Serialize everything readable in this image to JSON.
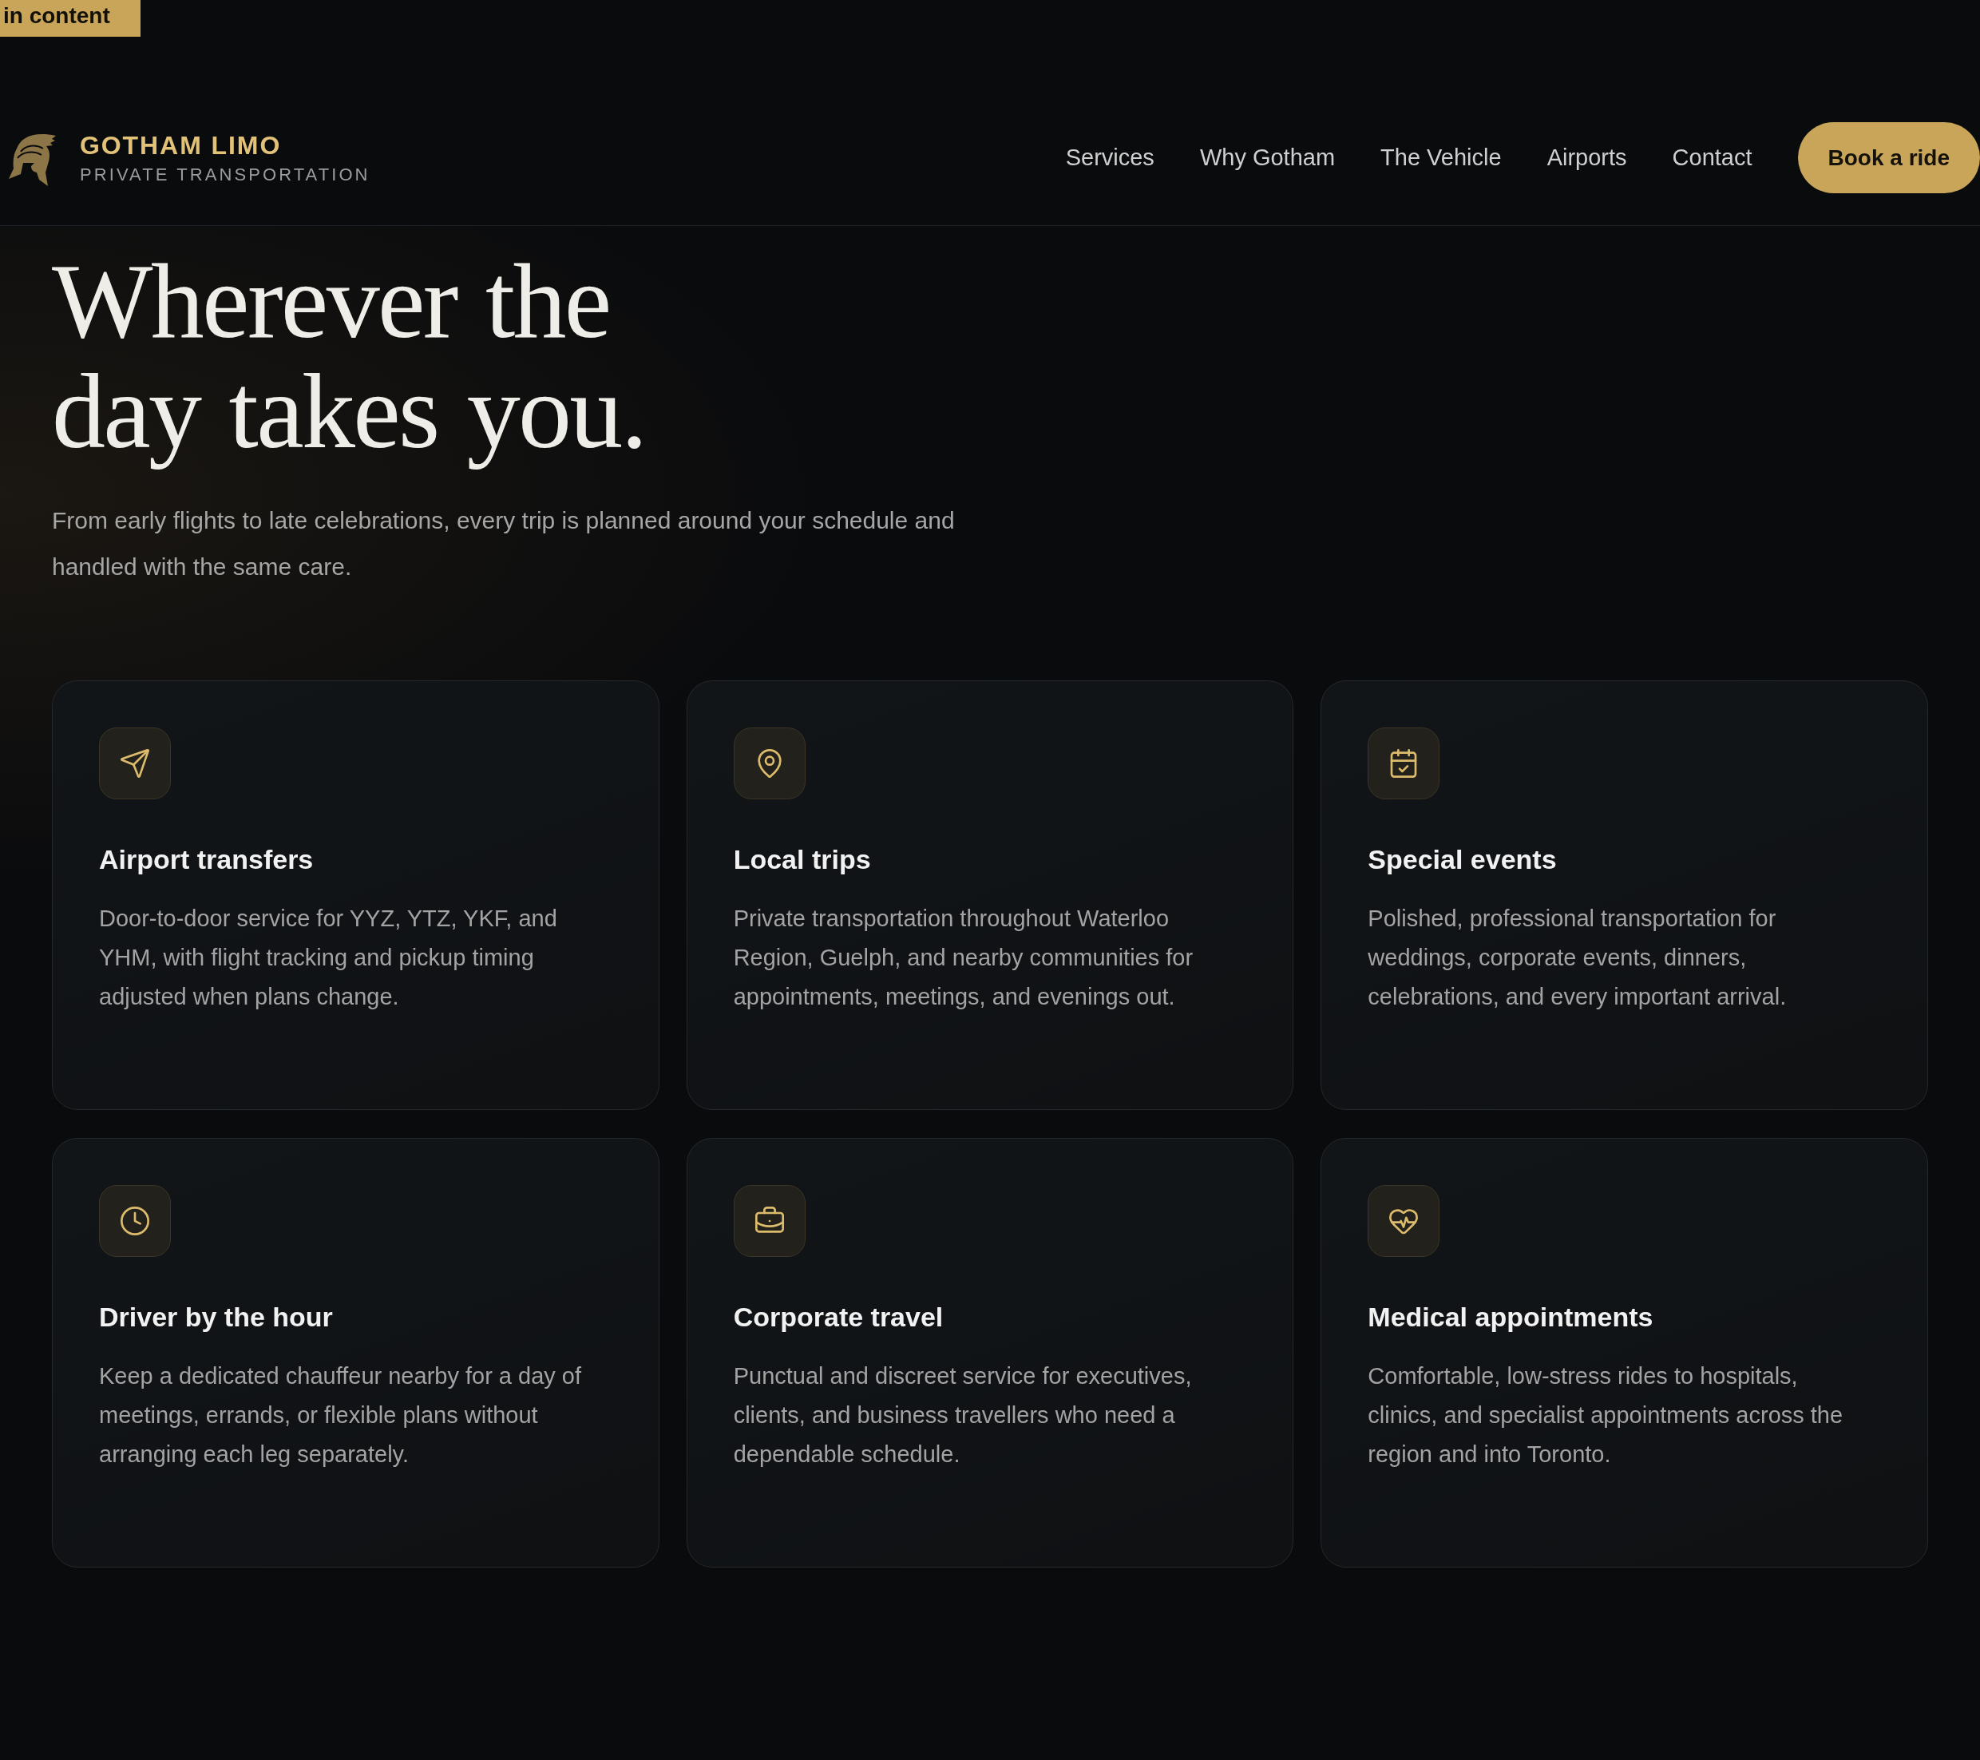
{
  "skip_link": {
    "label": "in content"
  },
  "header": {
    "brand": {
      "name": "GOTHAM LIMO",
      "tagline": "PRIVATE TRANSPORTATION"
    },
    "nav": [
      {
        "label": "Services"
      },
      {
        "label": "Why Gotham"
      },
      {
        "label": "The Vehicle"
      },
      {
        "label": "Airports"
      },
      {
        "label": "Contact"
      }
    ],
    "cta": {
      "label": "Book a ride"
    }
  },
  "hero": {
    "title": "Wherever the day takes you.",
    "subtitle": "From early flights to late celebrations, every trip is planned around your schedule and handled with the same care."
  },
  "services": [
    {
      "title": "Airport transfers",
      "description": "Door-to-door service for YYZ, YTZ, YKF, and YHM, with flight tracking and pickup timing adjusted when plans change."
    },
    {
      "title": "Local trips",
      "description": "Private transportation throughout Waterloo Region, Guelph, and nearby communities for appointments, meetings, and evenings out."
    },
    {
      "title": "Special events",
      "description": "Polished, professional transportation for weddings, corporate events, dinners, celebrations, and every important arrival."
    },
    {
      "title": "Driver by the hour",
      "description": "Keep a dedicated chauffeur nearby for a day of meetings, errands, or flexible plans without arranging each leg separately."
    },
    {
      "title": "Corporate travel",
      "description": "Punctual and discreet service for executives, clients, and business travellers who need a dependable schedule."
    },
    {
      "title": "Medical appointments",
      "description": "Comfortable, low-stress rides to hospitals, clinics, and specialist appointments across the region and into Toronto."
    }
  ]
}
